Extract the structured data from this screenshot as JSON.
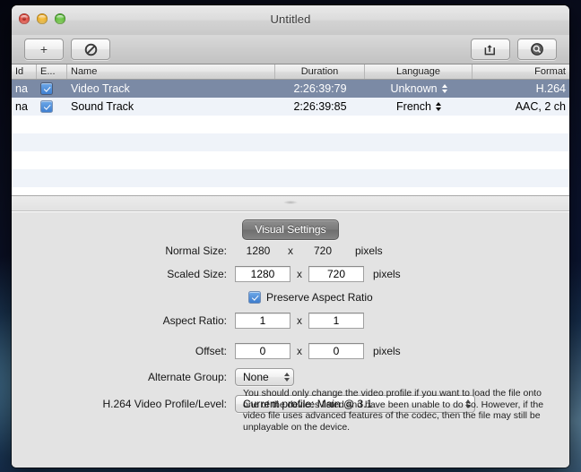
{
  "window": {
    "title": "Untitled",
    "controls": {
      "close": "close-button",
      "minimize": "minimize-button",
      "zoom": "zoom-button"
    }
  },
  "toolbar": {
    "add_label": "+",
    "remove_icon": "prohibited-icon",
    "export_icon": "export-share-icon",
    "inspect_icon": "magnifier-icon"
  },
  "table": {
    "columns": [
      {
        "key": "id",
        "label": "Id"
      },
      {
        "key": "enabled",
        "label": "E..."
      },
      {
        "key": "name",
        "label": "Name"
      },
      {
        "key": "duration",
        "label": "Duration"
      },
      {
        "key": "language",
        "label": "Language"
      },
      {
        "key": "format",
        "label": "Format"
      }
    ],
    "rows": [
      {
        "id": "na",
        "enabled": true,
        "name": "Video Track",
        "duration": "2:26:39:79",
        "language": "Unknown",
        "format": "H.264",
        "selected": true
      },
      {
        "id": "na",
        "enabled": true,
        "name": "Sound Track",
        "duration": "2:26:39:85",
        "language": "French",
        "format": "AAC, 2 ch",
        "selected": false
      }
    ]
  },
  "panel": {
    "tab_label": "Visual Settings",
    "fields": {
      "normal_size_label": "Normal Size:",
      "normal_width": "1280",
      "normal_height": "720",
      "scaled_size_label": "Scaled Size:",
      "scaled_width": "1280",
      "scaled_height": "720",
      "preserve_aspect_label": "Preserve Aspect Ratio",
      "preserve_aspect_checked": true,
      "aspect_ratio_label": "Aspect Ratio:",
      "aspect_w": "1",
      "aspect_h": "1",
      "offset_label": "Offset:",
      "offset_x": "0",
      "offset_y": "0",
      "alternate_group_label": "Alternate Group:",
      "alternate_group_value": "None",
      "profile_label": "H.264 Video Profile/Level:",
      "profile_value": "Current profile: Main @ 3.1",
      "x_separator": "x",
      "unit_pixels": "pixels"
    },
    "help_text": "You should only change the video profile if you want to load the file onto one of the devices listed and have been unable to do so.  However, if the video file uses advanced features of the codec, then the file may still be unplayable on the device."
  },
  "colors": {
    "selection": "#7b8aa5",
    "checkbox": "#3f7fd0",
    "window_bg": "#e3e3e3",
    "stripe": "#eff3f9"
  }
}
